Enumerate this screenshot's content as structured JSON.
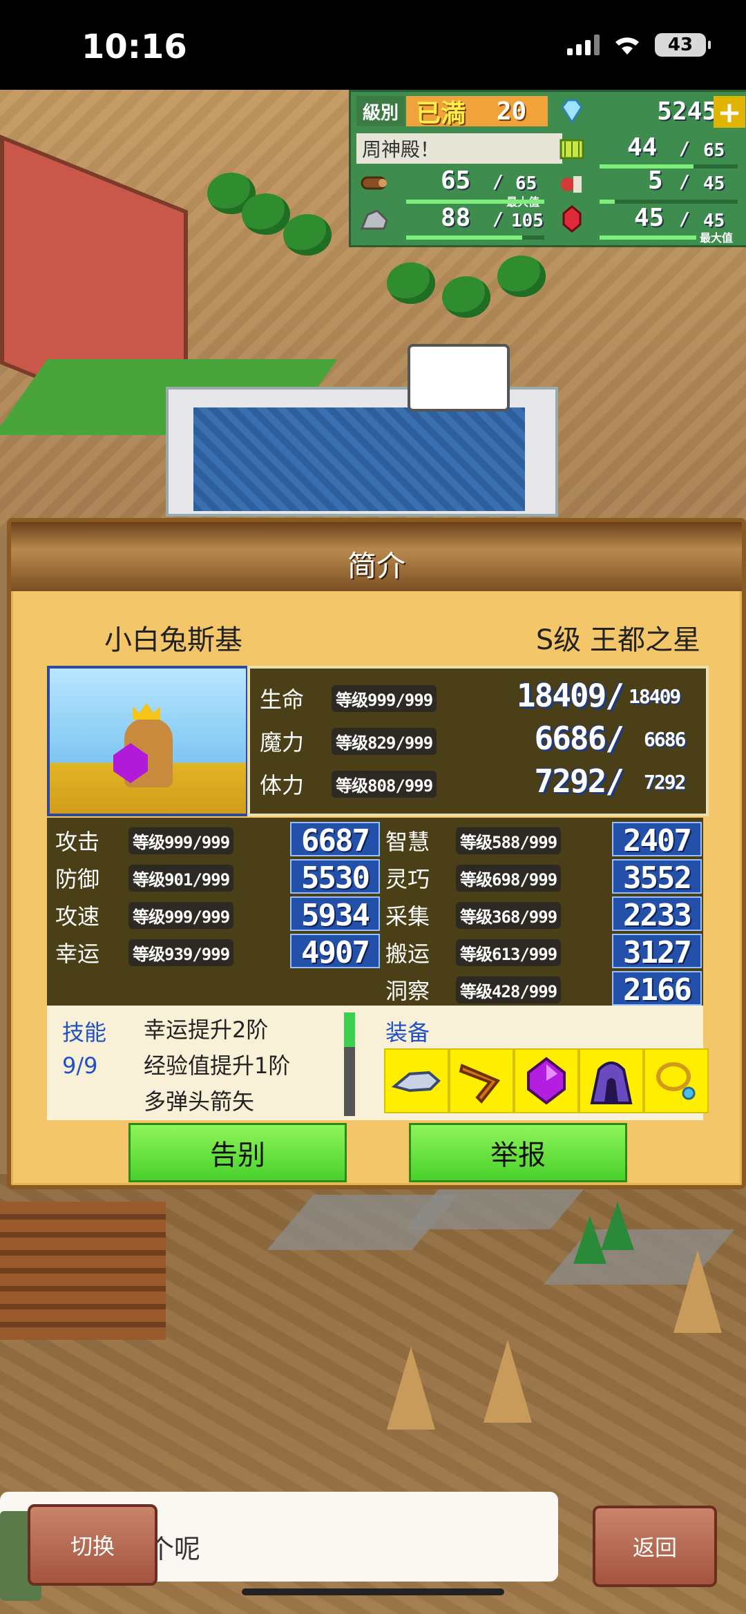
{
  "status_bar": {
    "time": "10:16",
    "battery": "43"
  },
  "resources": {
    "level_label": "級別",
    "level_status": "已満",
    "level_value": "20",
    "gems": "5245",
    "add_symbol": "+",
    "building_label": "周神殿！",
    "res1": {
      "value": "44",
      "max": "65"
    },
    "wood": {
      "value": "65",
      "max": "65",
      "note": "最大值"
    },
    "food": {
      "value": "5",
      "max": "45"
    },
    "ore": {
      "value": "88",
      "max": "105"
    },
    "crystal": {
      "value": "45",
      "max": "45",
      "note": "最大值"
    },
    "separator": "/"
  },
  "dialog": {
    "title": "简介",
    "name": "小白兔斯基",
    "rank": "S级 王都之星",
    "vitals": [
      {
        "label": "生命",
        "level": "等级999/999",
        "value": "18409/",
        "max": "18409"
      },
      {
        "label": "魔力",
        "level": "等级829/999",
        "value": "6686/",
        "max": "6686"
      },
      {
        "label": "体力",
        "level": "等级808/999",
        "value": "7292/",
        "max": "7292"
      }
    ],
    "stats_left": [
      {
        "label": "攻击",
        "level": "等级999/999",
        "value": "6687"
      },
      {
        "label": "防御",
        "level": "等级901/999",
        "value": "5530"
      },
      {
        "label": "攻速",
        "level": "等级999/999",
        "value": "5934"
      },
      {
        "label": "幸运",
        "level": "等级939/999",
        "value": "4907"
      }
    ],
    "stats_right": [
      {
        "label": "智慧",
        "level": "等级588/999",
        "value": "2407"
      },
      {
        "label": "灵巧",
        "level": "等级698/999",
        "value": "3552"
      },
      {
        "label": "采集",
        "level": "等级368/999",
        "value": "2233"
      },
      {
        "label": "搬运",
        "level": "等级613/999",
        "value": "3127"
      },
      {
        "label": "洞察",
        "level": "等级428/999",
        "value": "2166"
      }
    ],
    "skills_title": "技能",
    "skills_count": "9/9",
    "skills": [
      "幸运提升2阶",
      "经验值提升1阶",
      "多弹头箭矢"
    ],
    "equip_title": "装备",
    "equip_icons": [
      "gauntlet-icon",
      "boomerang-icon",
      "gem-icon",
      "hood-icon",
      "necklace-icon"
    ],
    "buttons": {
      "farewell": "告别",
      "report": "举报"
    }
  },
  "bottom": {
    "hint": "要选哪个呢",
    "switch": "切换",
    "back": "返回"
  }
}
